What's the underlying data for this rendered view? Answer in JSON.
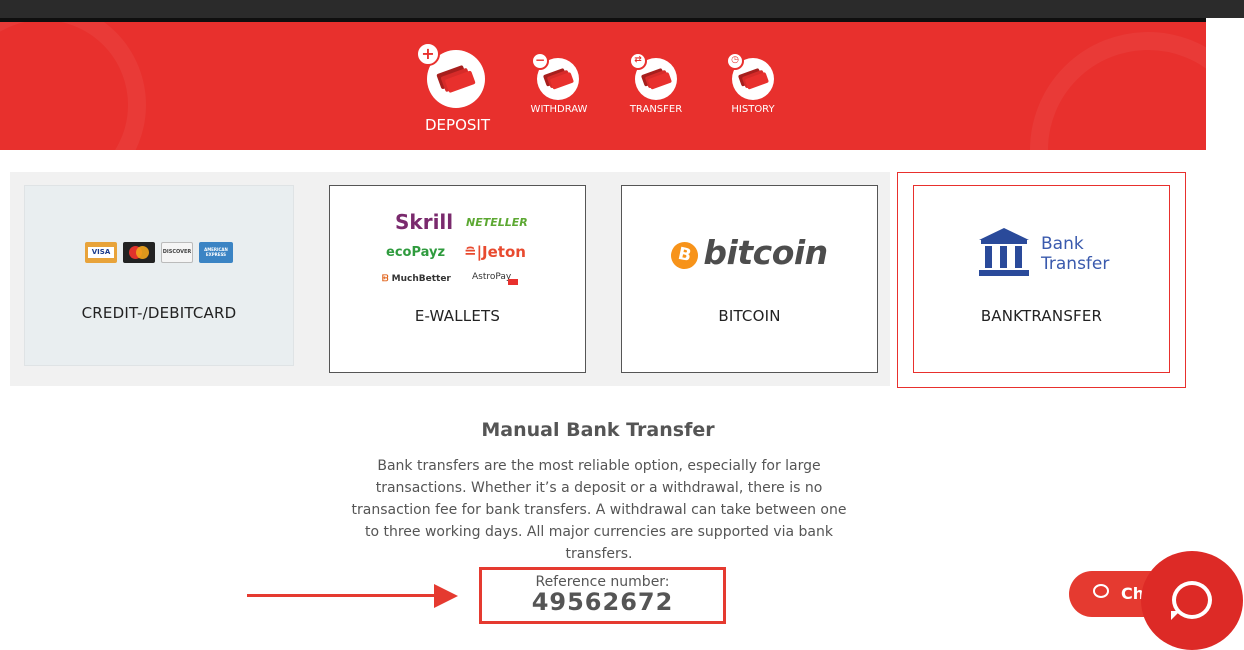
{
  "nav": {
    "deposit": "DEPOSIT",
    "withdraw": "WITHDRAW",
    "transfer": "TRANSFER",
    "history": "HISTORY"
  },
  "methods": {
    "card": {
      "label": "CREDIT-/DEBITCARD",
      "logos": [
        "VISA",
        "MasterCard",
        "DISCOVER",
        "AMERICAN EXPRESS"
      ]
    },
    "ewallets": {
      "label": "E-WALLETS",
      "logos": {
        "skrill": "Skrill",
        "neteller": "NETELLER",
        "ecopayz": "ecoPayz",
        "jeton": "Jeton",
        "muchbetter": "MuchBetter",
        "astropay": "AstroPay"
      }
    },
    "bitcoin": {
      "label": "BITCOIN",
      "logo": "bitcoin",
      "symbol": "B"
    },
    "bank": {
      "label": "BANKTRANSFER",
      "logo_line1": "Bank",
      "logo_line2": "Transfer"
    }
  },
  "content": {
    "title": "Manual Bank Transfer",
    "description": "Bank transfers are the most reliable option, especially for large transactions. Whether it’s a deposit or a withdrawal, there is no transaction fee for bank transfers. A withdrawal can take between one to three working days. All major currencies are supported via bank transfers.",
    "reference_label": "Reference number:",
    "reference_number": "49562672"
  },
  "chat": {
    "label": "Ch"
  },
  "colors": {
    "brand_red": "#e8302d",
    "text_gray": "#555555"
  }
}
